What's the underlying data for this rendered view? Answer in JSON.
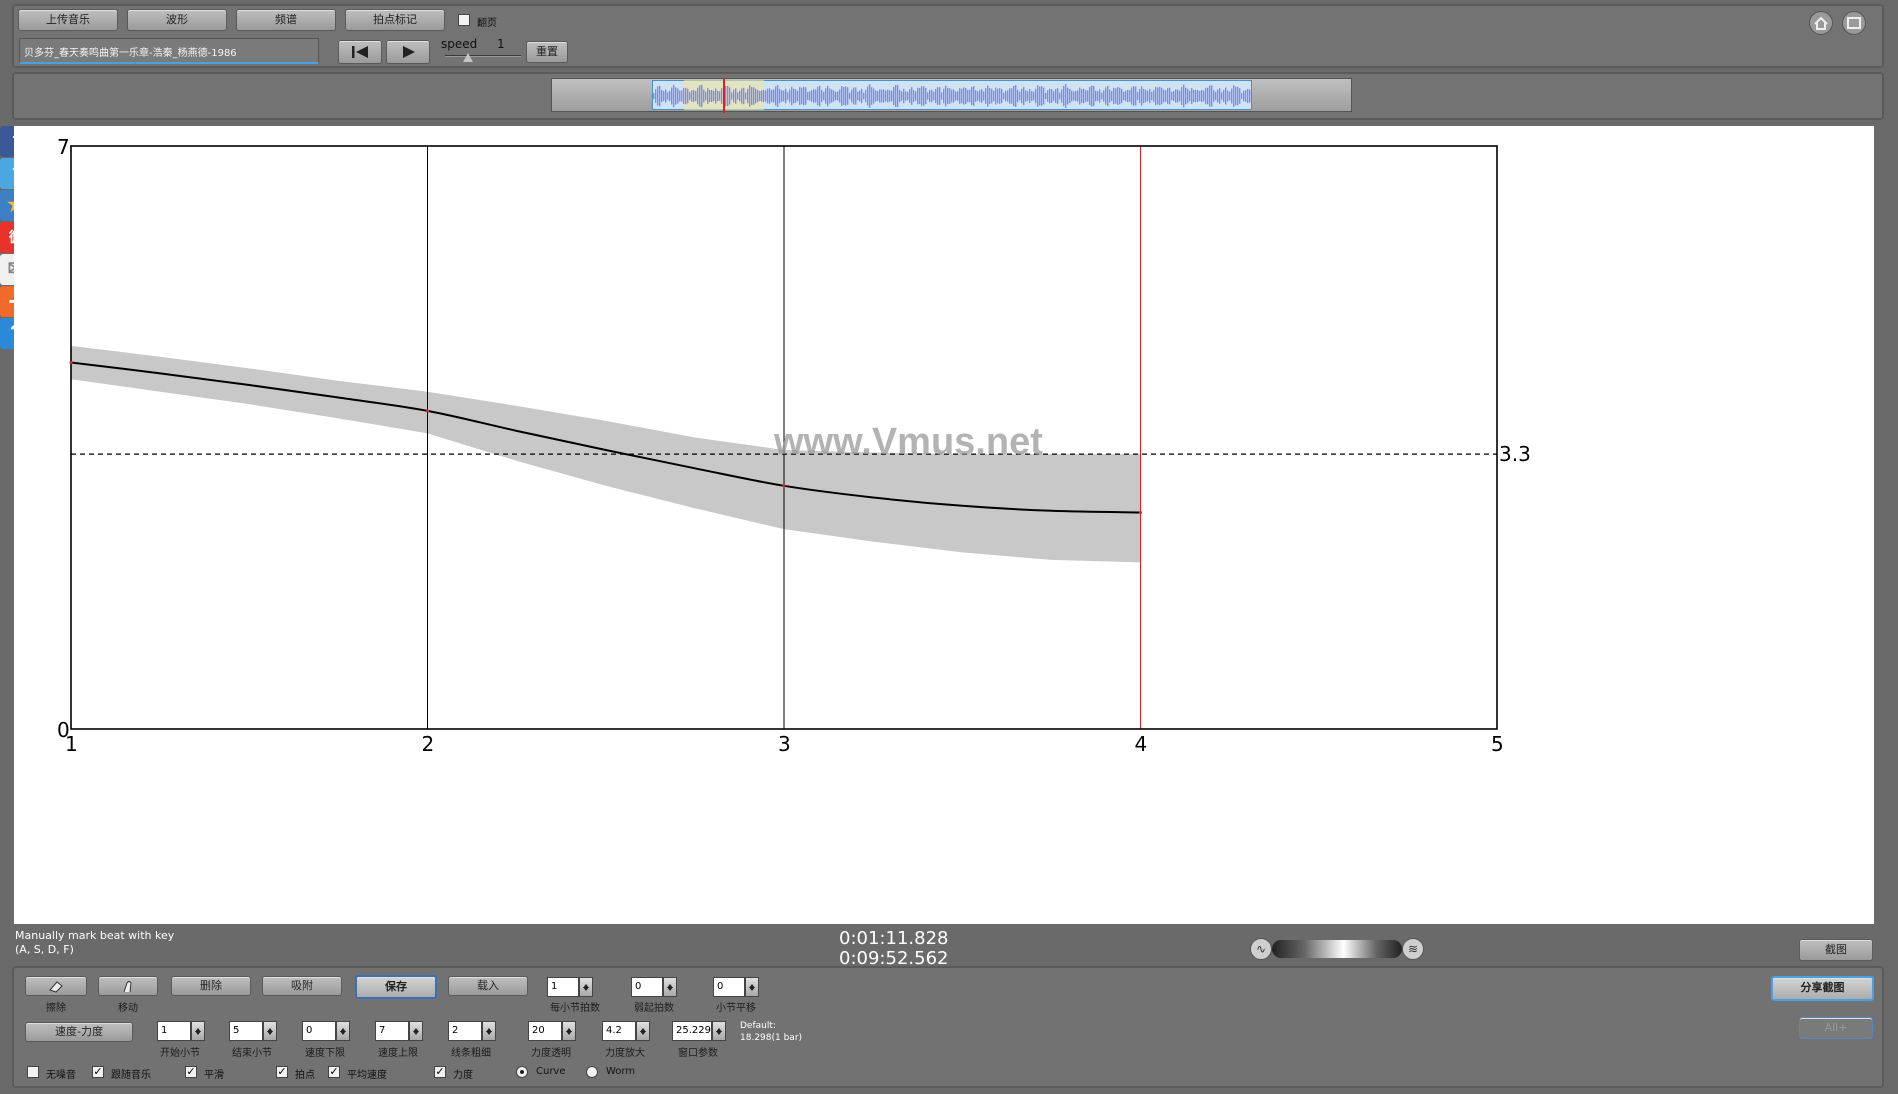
{
  "toolbar": {
    "upload_label": "上传音乐",
    "waveform_label": "波形",
    "spectrum_label": "频谱",
    "beat_mark_label": "拍点标记",
    "flip_page_label": "翻页",
    "track_title": "贝多芬_春天奏鸣曲第一乐章-浩秦_杨燕德-1986",
    "speed_label": "speed",
    "speed_value": "1",
    "reset_label": "重置"
  },
  "chart_data": {
    "type": "line",
    "title": "",
    "xlabel": "",
    "ylabel": "",
    "xlim": [
      1,
      5
    ],
    "ylim": [
      0,
      7
    ],
    "x_ticks": [
      "1",
      "2",
      "3",
      "4",
      "5"
    ],
    "y_min_label": "0",
    "y_max_label": "7",
    "reference_line": {
      "value": 3.3,
      "label": "3.3",
      "style": "dashed"
    },
    "playhead_x": 4,
    "series": [
      {
        "x": [
          1,
          1.25,
          1.5,
          1.75,
          2,
          2.25,
          2.5,
          2.75,
          3,
          3.25,
          3.5,
          3.75,
          4
        ],
        "y": [
          4.4,
          4.27,
          4.13,
          3.98,
          3.82,
          3.58,
          3.35,
          3.13,
          2.92,
          2.78,
          2.68,
          2.62,
          2.6
        ],
        "lower": [
          4.2,
          4.05,
          3.9,
          3.73,
          3.55,
          3.22,
          2.92,
          2.65,
          2.4,
          2.25,
          2.12,
          2.03,
          2.0
        ],
        "upper": [
          4.6,
          4.47,
          4.33,
          4.18,
          4.05,
          3.88,
          3.7,
          3.5,
          3.35,
          3.32,
          3.3,
          3.3,
          3.3
        ]
      }
    ]
  },
  "watermark": "www.Vmus.net",
  "status": {
    "hint_line1": "Manually mark beat with key",
    "hint_line2": "(A, S, D, F)",
    "time_current": "0:01:11.828",
    "time_total": "0:09:52.562",
    "screenshot_label": "截图",
    "share_label": "分享截图",
    "disabled_label": "All+"
  },
  "controls": {
    "erase_label": "擦除",
    "move_label": "移动",
    "delete_label": "删除",
    "snap_label": "吸附",
    "save_label": "保存",
    "load_label": "载入",
    "beats_per_bar": {
      "value": "1",
      "label": "每小节拍数"
    },
    "pickup_beats": {
      "value": "0",
      "label": "弱起拍数"
    },
    "bar_shift": {
      "value": "0",
      "label": "小节平移"
    },
    "mode_label": "速度-力度",
    "start_bar": {
      "value": "1",
      "label": "开始小节"
    },
    "end_bar": {
      "value": "5",
      "label": "结束小节"
    },
    "tempo_min": {
      "value": "0",
      "label": "速度下限"
    },
    "tempo_max": {
      "value": "7",
      "label": "速度上限"
    },
    "line_width": {
      "value": "2",
      "label": "线条粗细"
    },
    "dyn_opacity": {
      "value": "20",
      "label": "力度透明"
    },
    "dyn_scale": {
      "value": "4.2",
      "label": "力度放大"
    },
    "window_param": {
      "value": "25.229",
      "label": "窗口参数"
    },
    "default_note_1": "Default:",
    "default_note_2": "18.298(1 bar)",
    "checks": {
      "no_mute": "无噪音",
      "follow_music": "跟随音乐",
      "smooth": "平滑",
      "beats": "拍点",
      "avg_tempo": "平均速度",
      "dynamics": "力度"
    },
    "check_mark": "✓",
    "curve_label": "Curve",
    "worm_label": "Worm"
  },
  "social": {
    "facebook": "f",
    "twitter": "t",
    "favorite": "★",
    "weibo": "微",
    "mail": "✉",
    "more": "+",
    "help": "?"
  },
  "colors": {
    "accent": "#3a6fb7",
    "playhead": "#e02020",
    "band": "#c8c8c8",
    "wave": "#7f8ce8"
  }
}
